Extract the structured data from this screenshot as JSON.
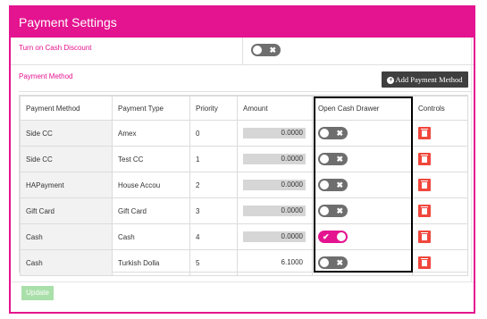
{
  "header": {
    "title": "Payment Settings"
  },
  "cash_discount": {
    "label": "Turn on Cash Discount",
    "enabled": false
  },
  "payment_method_section": {
    "label": "Payment Method",
    "add_button": "Add Payment Method"
  },
  "table": {
    "columns": [
      "Payment Method",
      "Payment Type",
      "Priority",
      "Amount",
      "Open Cash Drawer",
      "Controls"
    ],
    "rows": [
      {
        "method": "Side CC",
        "type": "Amex",
        "priority": "0",
        "amount": "0.0000",
        "amount_editable": true,
        "open_cash_drawer": false
      },
      {
        "method": "Side CC",
        "type": "Test CC",
        "priority": "1",
        "amount": "0.0000",
        "amount_editable": true,
        "open_cash_drawer": false
      },
      {
        "method": "HAPayment",
        "type": "House Accou",
        "priority": "2",
        "amount": "0.0000",
        "amount_editable": true,
        "open_cash_drawer": false
      },
      {
        "method": "Gift Card",
        "type": "Gift Card",
        "priority": "3",
        "amount": "0.0000",
        "amount_editable": true,
        "open_cash_drawer": false
      },
      {
        "method": "Cash",
        "type": "Cash",
        "priority": "4",
        "amount": "0.0000",
        "amount_editable": true,
        "open_cash_drawer": true
      },
      {
        "method": "Cash",
        "type": "Turkish Dolla",
        "priority": "5",
        "amount": "6.1000",
        "amount_editable": false,
        "open_cash_drawer": false
      }
    ]
  },
  "footer": {
    "update_button": "Update"
  },
  "icons": {
    "toggle_off": "x-mark-icon",
    "toggle_on": "check-mark-icon",
    "delete": "trash-icon",
    "add": "plus-circle-icon"
  },
  "colors": {
    "accent": "#e4138f",
    "delete": "#f0473c",
    "update_disabled": "#a9dfa9",
    "add_button": "#3f3f3f"
  }
}
